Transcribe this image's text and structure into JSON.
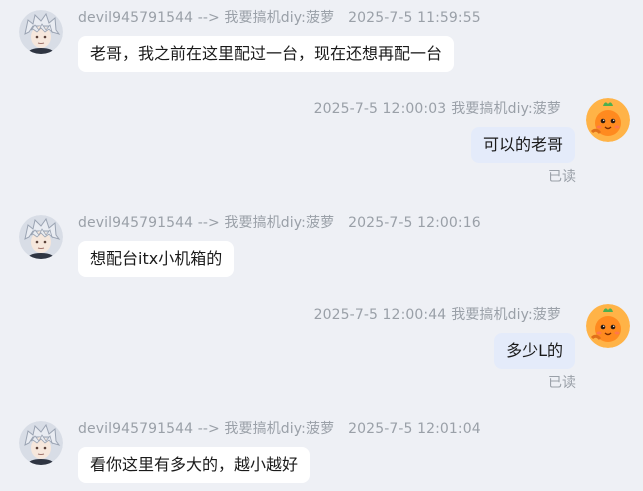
{
  "messages": [
    {
      "direction": "incoming",
      "sender": "devil945791544",
      "arrow": "-->",
      "recipient": "我要搞机diy:菠萝",
      "timestamp": "2025-7-5 11:59:55",
      "text": "老哥，我之前在这里配过一台，现在还想再配一台"
    },
    {
      "direction": "outgoing",
      "timestamp": "2025-7-5 12:00:03",
      "sender": "我要搞机diy:菠萝",
      "text": "可以的老哥",
      "status": "已读"
    },
    {
      "direction": "incoming",
      "sender": "devil945791544",
      "arrow": "-->",
      "recipient": "我要搞机diy:菠萝",
      "timestamp": "2025-7-5 12:00:16",
      "text": "想配台itx小机箱的"
    },
    {
      "direction": "outgoing",
      "timestamp": "2025-7-5 12:00:44",
      "sender": "我要搞机diy:菠萝",
      "text": "多少L的",
      "status": "已读"
    },
    {
      "direction": "incoming",
      "sender": "devil945791544",
      "arrow": "-->",
      "recipient": "我要搞机diy:菠萝",
      "timestamp": "2025-7-5 12:01:04",
      "text": "看你这里有多大的，越小越好"
    }
  ],
  "colors": {
    "background": "#eef0f5",
    "incoming_bubble": "#ffffff",
    "outgoing_bubble": "#e4ebfa",
    "meta_text": "#9aa0a8",
    "message_text": "#1a1a1a"
  },
  "icons": {
    "incoming_avatar": "anime-silver-hair-avatar",
    "outgoing_avatar": "orange-pineapple-mascot-avatar"
  }
}
